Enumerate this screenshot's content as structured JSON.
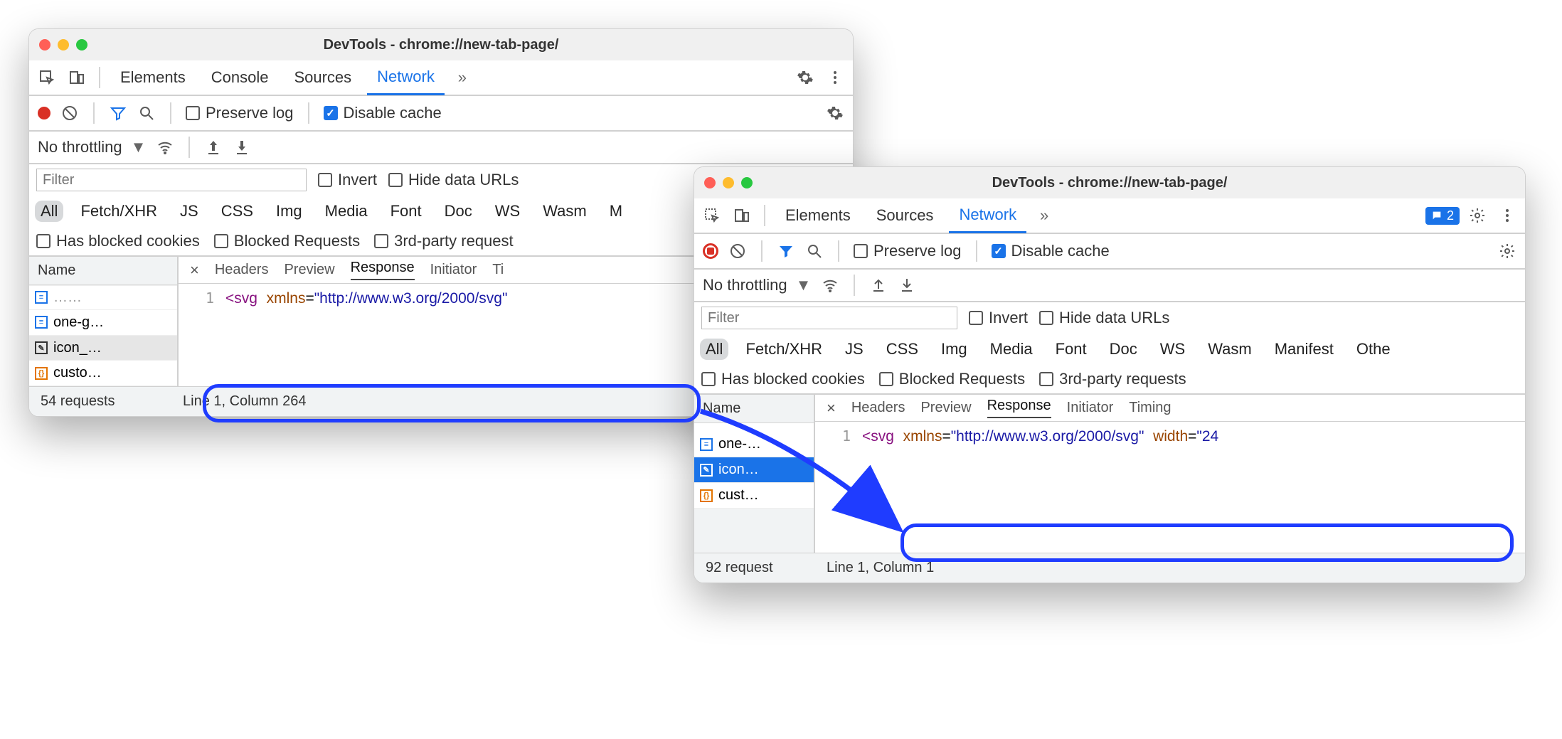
{
  "window1": {
    "title": "DevTools - chrome://new-tab-page/",
    "main_tabs": [
      "Elements",
      "Console",
      "Sources",
      "Network"
    ],
    "active_tab": "Network",
    "preserve_log": "Preserve log",
    "disable_cache": "Disable cache",
    "throttling": "No throttling",
    "filter_placeholder": "Filter",
    "invert": "Invert",
    "hide_urls": "Hide data URLs",
    "type_filters": [
      "All",
      "Fetch/XHR",
      "JS",
      "CSS",
      "Img",
      "Media",
      "Font",
      "Doc",
      "WS",
      "Wasm",
      "M"
    ],
    "blocked_cookies": "Has blocked cookies",
    "blocked_requests": "Blocked Requests",
    "third_party": "3rd-party request",
    "sidebar_header": "Name",
    "files": [
      "one-g…",
      "icon_…",
      "custo…"
    ],
    "content_tabs": [
      "Headers",
      "Preview",
      "Response",
      "Initiator",
      "Ti"
    ],
    "active_ctab": "Response",
    "line_no": "1",
    "code_tag": "<svg",
    "code_attr1": "xmlns",
    "code_str1": "\"http://www.w3.org/2000/svg\"",
    "status_requests": "54 requests",
    "status_line": "Line 1, Column 264"
  },
  "window2": {
    "title": "DevTools - chrome://new-tab-page/",
    "main_tabs": [
      "Elements",
      "Sources",
      "Network"
    ],
    "active_tab": "Network",
    "issues_count": "2",
    "preserve_log": "Preserve log",
    "disable_cache": "Disable cache",
    "throttling": "No throttling",
    "filter_placeholder": "Filter",
    "invert": "Invert",
    "hide_urls": "Hide data URLs",
    "type_filters": [
      "All",
      "Fetch/XHR",
      "JS",
      "CSS",
      "Img",
      "Media",
      "Font",
      "Doc",
      "WS",
      "Wasm",
      "Manifest",
      "Othe"
    ],
    "blocked_cookies": "Has blocked cookies",
    "blocked_requests": "Blocked Requests",
    "third_party": "3rd-party requests",
    "sidebar_header": "Name",
    "files": [
      "one-…",
      "icon…",
      "cust…"
    ],
    "content_tabs": [
      "Headers",
      "Preview",
      "Response",
      "Initiator",
      "Timing"
    ],
    "active_ctab": "Response",
    "line_no": "1",
    "code_tag": "<svg",
    "code_attr1": "xmlns",
    "code_str1": "\"http://www.w3.org/2000/svg\"",
    "code_attr2": "width",
    "code_str2": "\"24",
    "status_requests": "92 request",
    "status_line": "Line 1, Column 1"
  }
}
